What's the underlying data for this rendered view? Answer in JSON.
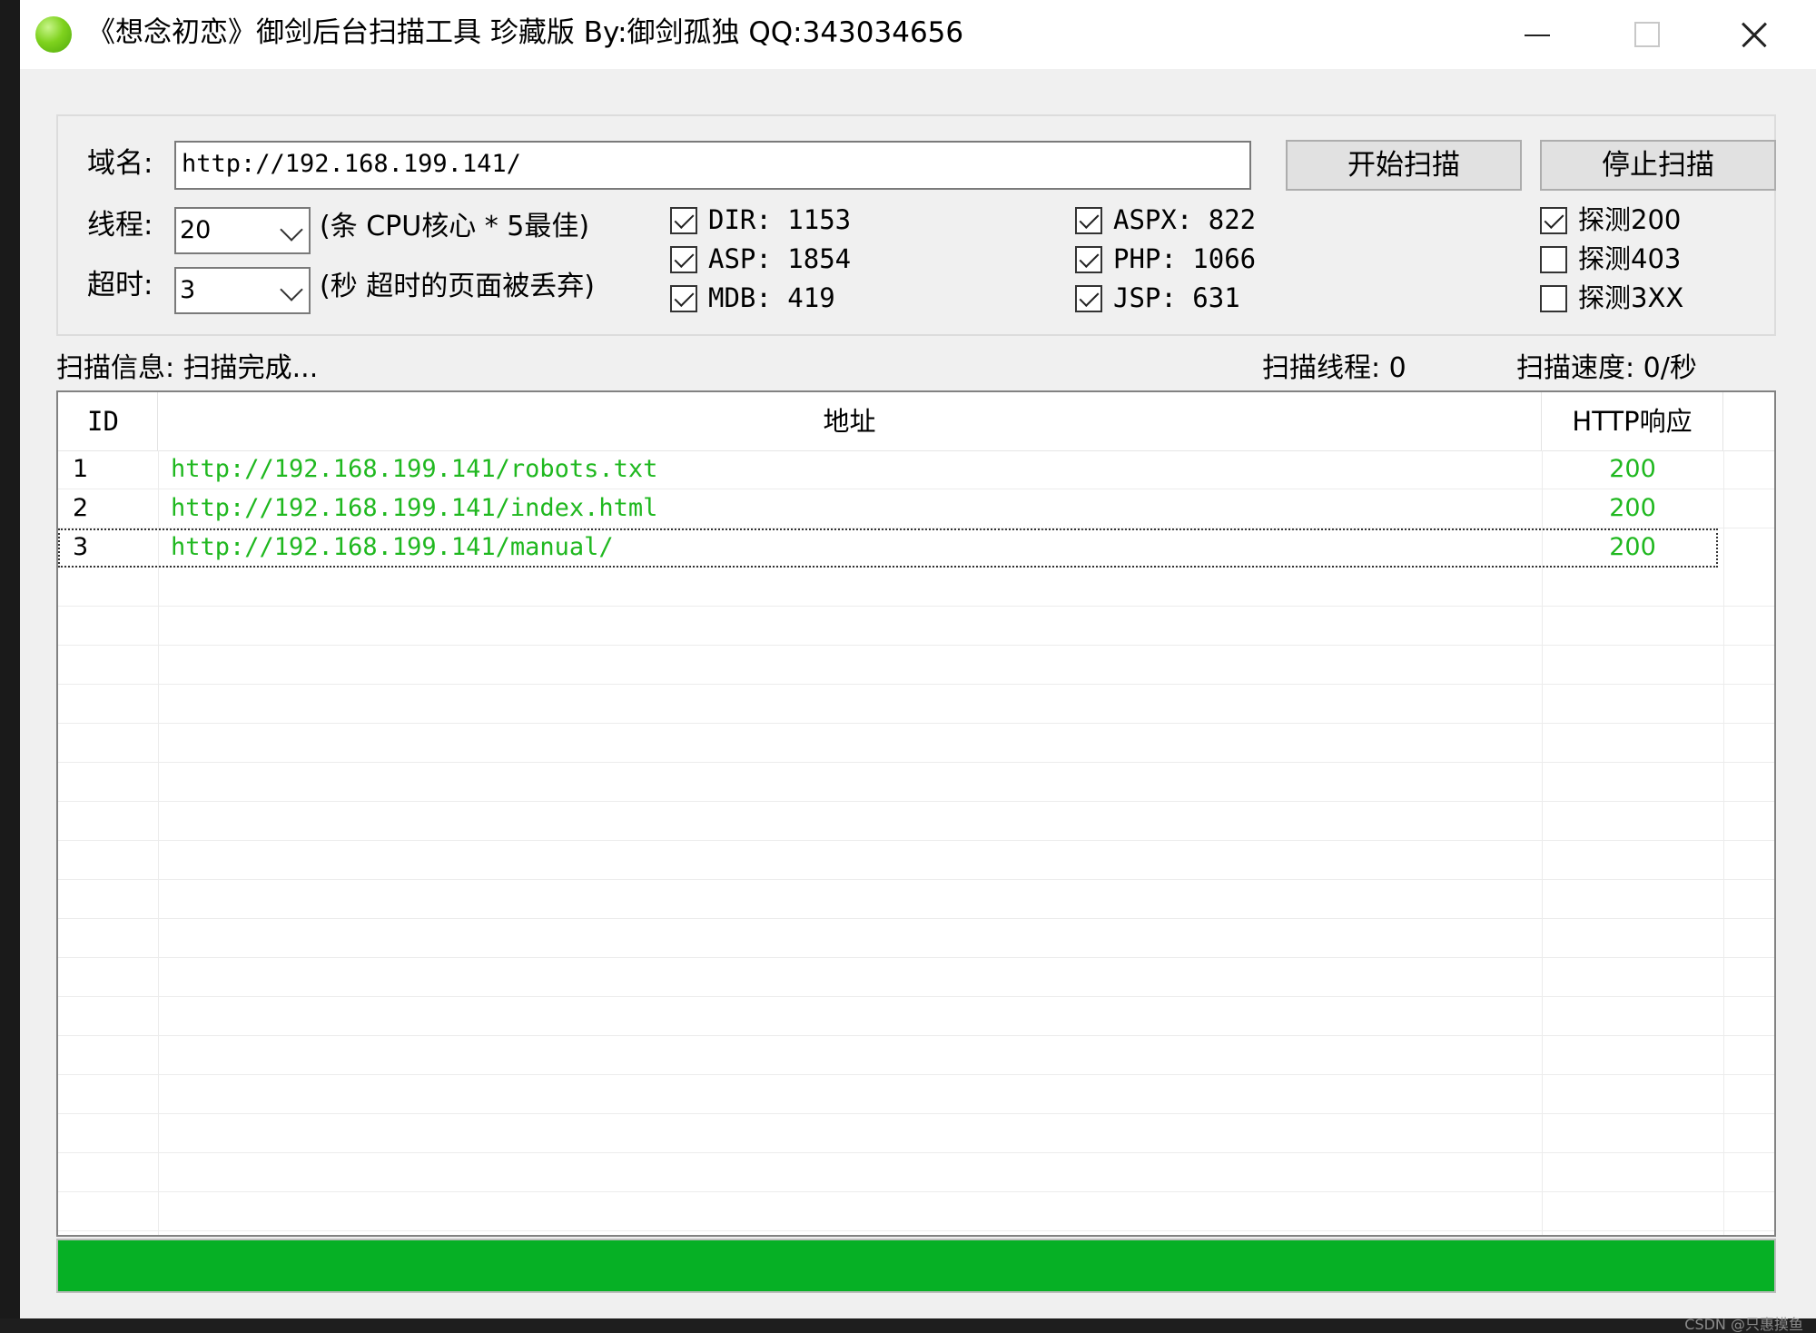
{
  "window": {
    "title": "《想念初恋》御剑后台扫描工具 珍藏版 By:御剑孤独 QQ:343034656"
  },
  "form": {
    "domain_label": "域名:",
    "domain_value": "http://192.168.199.141/",
    "start_button": "开始扫描",
    "stop_button": "停止扫描",
    "threads_label": "线程:",
    "threads_value": "20",
    "threads_hint": "(条 CPU核心 * 5最佳)",
    "timeout_label": "超时:",
    "timeout_value": "3",
    "timeout_hint": "(秒 超时的页面被丢弃)"
  },
  "dicts": [
    {
      "label": "DIR: 1153",
      "checked": true
    },
    {
      "label": "ASP: 1854",
      "checked": true
    },
    {
      "label": "MDB: 419",
      "checked": true
    },
    {
      "label": "ASPX: 822",
      "checked": true
    },
    {
      "label": "PHP: 1066",
      "checked": true
    },
    {
      "label": "JSP: 631",
      "checked": true
    }
  ],
  "probes": [
    {
      "label": "探测200",
      "checked": true
    },
    {
      "label": "探测403",
      "checked": false
    },
    {
      "label": "探测3XX",
      "checked": false
    }
  ],
  "status": {
    "info": "扫描信息: 扫描完成...",
    "threads": "扫描线程: 0",
    "speed": "扫描速度: 0/秒"
  },
  "table": {
    "columns": [
      "ID",
      "地址",
      "HTTP响应"
    ],
    "rows": [
      {
        "id": "1",
        "url": "http://192.168.199.141/robots.txt",
        "code": "200"
      },
      {
        "id": "2",
        "url": "http://192.168.199.141/index.html",
        "code": "200"
      },
      {
        "id": "3",
        "url": "http://192.168.199.141/manual/",
        "code": "200"
      }
    ]
  },
  "progress": {
    "value": 1.0
  },
  "colors": {
    "result_text": "#1fb81f",
    "progress": "#06b025"
  },
  "watermark": "CSDN @只惠摸鱼"
}
